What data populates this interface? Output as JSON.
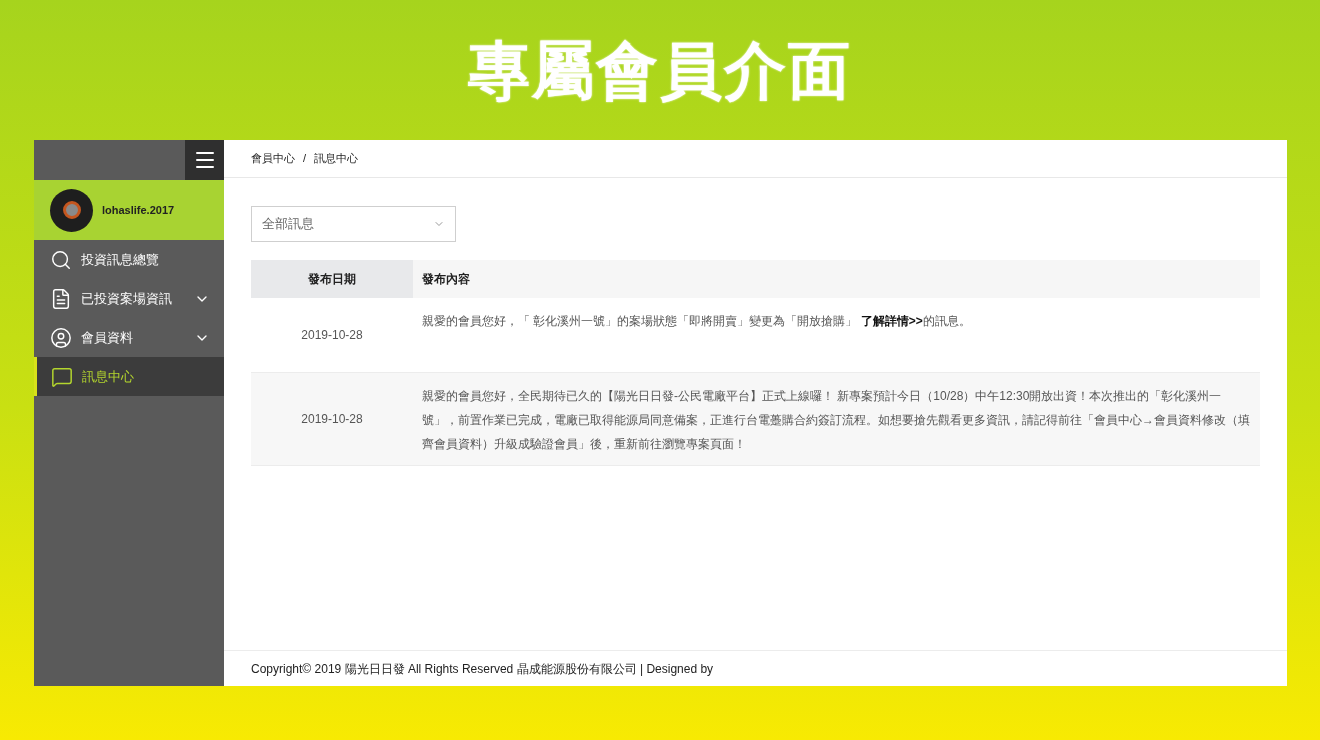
{
  "banner": {
    "title": "專屬會員介面"
  },
  "sidebar": {
    "username": "lohaslife.2017",
    "items": [
      {
        "label": "投資訊息總覽",
        "expandable": false,
        "selected": false
      },
      {
        "label": "已投資案場資訊",
        "expandable": true,
        "selected": false
      },
      {
        "label": "會員資料",
        "expandable": true,
        "selected": false
      },
      {
        "label": "訊息中心",
        "expandable": false,
        "selected": true
      }
    ]
  },
  "breadcrumb": [
    "會員中心",
    "/",
    "訊息中心"
  ],
  "filter": {
    "value": "全部訊息"
  },
  "table": {
    "columns": [
      "發布日期",
      "發布內容"
    ],
    "rows": [
      {
        "date": "2019-10-28",
        "content": "親愛的會員您好，「 彰化溪州一號」的案場狀態「即將開賣」變更為「開放搶購」 **了解詳情>>**的訊息。"
      },
      {
        "date": "2019-10-28",
        "content": "親愛的會員您好，全民期待已久的【陽光日日發-公民電廠平台】正式上線囉！ 新專案預計今日（10/28）中午12:30開放出資！本次推出的「彰化溪州一號」，前置作業已完成，電廠已取得能源局同意備案，正進行台電躉購合約簽訂流程。如想要搶先觀看更多資訊，請記得前往「會員中心→會員資料修改（填齊會員資料）升級成驗證會員」後，重新前往瀏覽專案頁面！"
      }
    ]
  },
  "footer": "Copyright© 2019 陽光日日發 All Rights Reserved 晶成能源股份有限公司 | Designed by"
}
